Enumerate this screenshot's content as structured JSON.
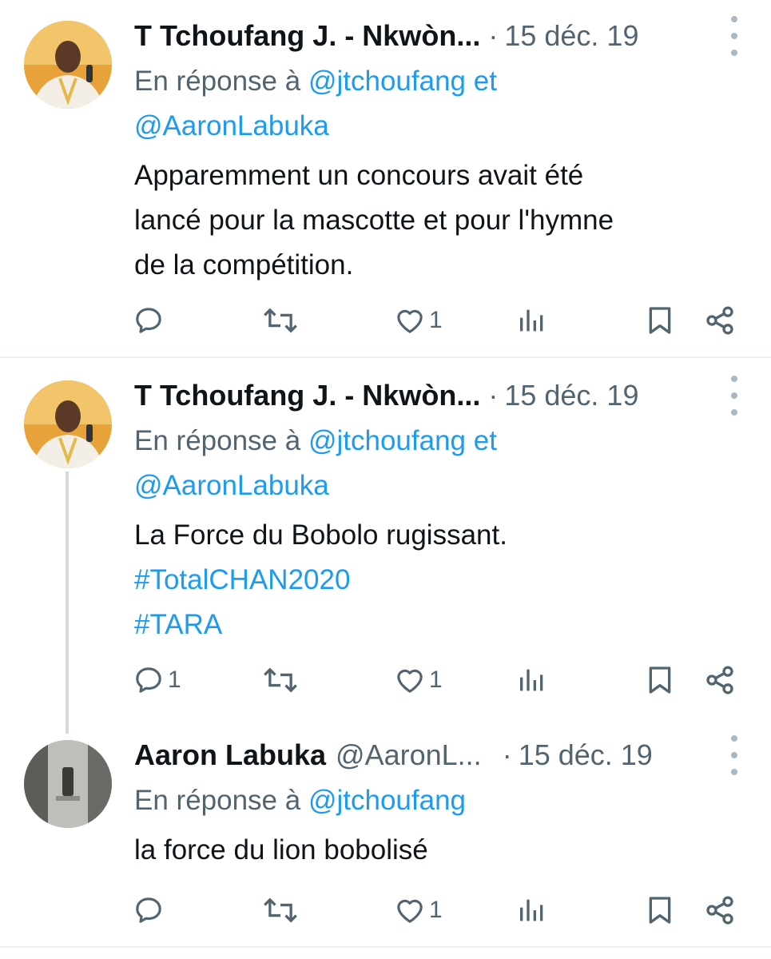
{
  "tweets": [
    {
      "name": "T Tchoufang J. - Nkwòn...",
      "handle": "",
      "date": "15 déc. 19",
      "reply_prefix": "En réponse à",
      "mentions_line1": "@jtchoufang et",
      "mentions_line2": "@AaronLabuka",
      "text": [
        "Apparemment un concours avait été",
        "lancé pour la mascotte et pour l'hymne",
        "de la compétition."
      ],
      "hashtags": [],
      "actions": {
        "replies": "",
        "retweets": "",
        "likes": "1"
      }
    },
    {
      "name": "T Tchoufang J. - Nkwòn...",
      "handle": "",
      "date": "15 déc. 19",
      "reply_prefix": "En réponse à",
      "mentions_line1": "@jtchoufang et",
      "mentions_line2": "@AaronLabuka",
      "text": [
        "La Force du Bobolo rugissant."
      ],
      "hashtags": [
        "#TotalCHAN2020",
        "#TARA"
      ],
      "actions": {
        "replies": "1",
        "retweets": "",
        "likes": "1"
      }
    },
    {
      "name": "Aaron Labuka",
      "handle": "@AaronL...",
      "date": "15 déc. 19",
      "reply_prefix": "En réponse à",
      "mentions_line1": "@jtchoufang",
      "text": [
        "la force du lion bobolisé"
      ],
      "actions": {
        "replies": "",
        "retweets": "",
        "likes": "1"
      }
    }
  ],
  "separator_dot": "·",
  "icons": [
    "comment-icon",
    "retweet-icon",
    "heart-icon",
    "views-icon",
    "bookmark-icon",
    "share-icon",
    "more-icon"
  ],
  "colors": {
    "accent": "#1d9bf0",
    "secondary_text": "#536471",
    "primary_text": "#0f1419",
    "separator": "#eff3f4"
  }
}
